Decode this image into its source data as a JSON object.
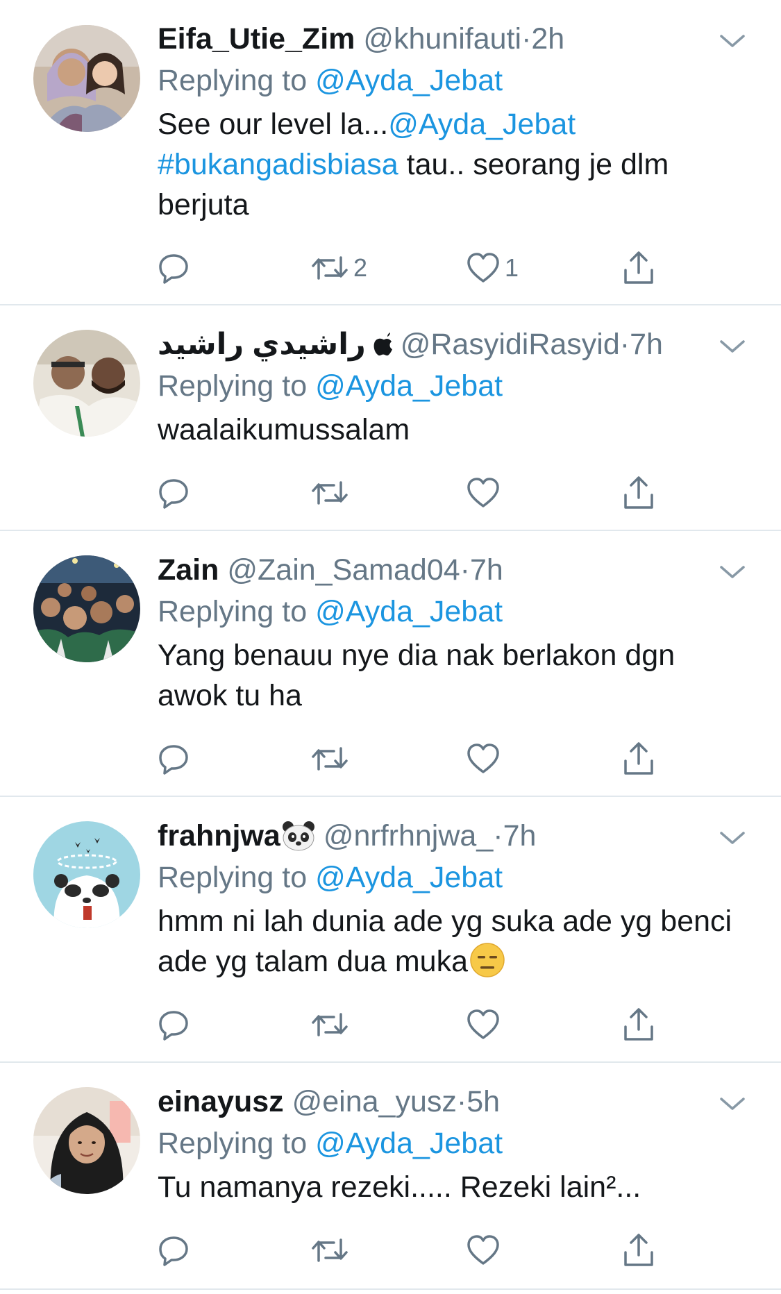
{
  "colors": {
    "primary_text": "#14171a",
    "secondary_text": "#657786",
    "link": "#1b95e0",
    "divider": "#e1e8ed",
    "background": "#ffffff"
  },
  "icons": {
    "reply": "reply-icon",
    "retweet": "retweet-icon",
    "like": "like-icon",
    "share": "share-icon",
    "caret": "chevron-down-icon"
  },
  "reply_prefix": "Replying to",
  "tweets": [
    {
      "display_name": "Eifa_Utie_Zim",
      "handle": "@khunifauti",
      "dot": "·",
      "time": "2h",
      "replying_to": "@Ayda_Jebat",
      "text_mention": "@Ayda_Jebat",
      "text_part1": "See our level la...",
      "text_hashtag": "#bukangadisbiasa",
      "text_part2": " tau.. seorang je dlm berjuta",
      "retweets": "2",
      "likes": "1"
    },
    {
      "display_name": "راشيدي راشيد",
      "name_badge": "apple-icon",
      "handle": "@RasyidiRasyid",
      "dot": "·",
      "time": "7h",
      "replying_to": "@Ayda_Jebat",
      "text": "waalaikumussalam",
      "retweets": "",
      "likes": ""
    },
    {
      "display_name": "Zain",
      "handle": "@Zain_Samad04",
      "dot": "·",
      "time": "7h",
      "replying_to": "@Ayda_Jebat",
      "text": "Yang benauu nye dia nak berlakon dgn awok tu ha",
      "retweets": "",
      "likes": ""
    },
    {
      "display_name": "frahnjwa",
      "name_badge": "panda-face-emoji",
      "handle": "@nrfrhnjwa_",
      "dot": "·",
      "time": "7h",
      "replying_to": "@Ayda_Jebat",
      "text": "hmm ni lah dunia ade yg suka ade yg benci ade yg talam dua muka",
      "text_emoji": "expressionless-face-emoji",
      "retweets": "",
      "likes": ""
    },
    {
      "display_name": "einayusz",
      "handle": "@eina_yusz",
      "dot": "·",
      "time": "5h",
      "replying_to": "@Ayda_Jebat",
      "text": "Tu namanya rezeki..... Rezeki lain²...",
      "retweets": "",
      "likes": ""
    }
  ]
}
